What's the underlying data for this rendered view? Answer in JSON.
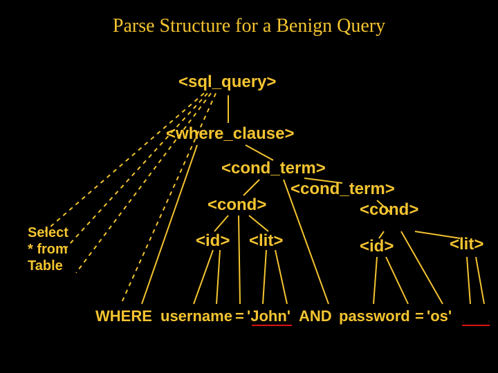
{
  "title": "Parse Structure for a Benign Query",
  "tree": {
    "root": "<sql_query>",
    "where": "<where_clause>",
    "cond_term1": "<cond_term>",
    "cond1": "<cond>",
    "cond_term2": "<cond_term>",
    "cond2": "<cond>",
    "id1": "<id>",
    "lit1": "<lit>",
    "id2": "<id>",
    "lit2": "<lit>"
  },
  "leaf_label": "Select\n* from\nTable",
  "sql": {
    "where_kw": "WHERE",
    "username": "username",
    "eq1": "=",
    "john": "'John'",
    "and_kw": "AND",
    "password": "password",
    "eq2": "=",
    "os": "'os'"
  }
}
